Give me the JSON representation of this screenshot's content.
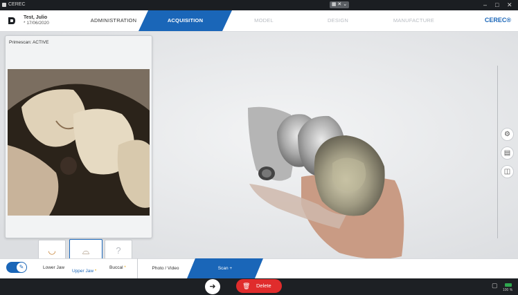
{
  "window": {
    "title": "CEREC"
  },
  "header": {
    "patient_name": "Test, Julio",
    "patient_dob": "* 17/06/2020",
    "steps": [
      "ADMINISTRATION",
      "ACQUISITION",
      "MODEL",
      "DESIGN",
      "MANUFACTURE"
    ],
    "brand": "CEREC®"
  },
  "live_panel": {
    "label": "Primescan: ACTIVE"
  },
  "scan_catalog": {
    "items": [
      {
        "label": "Lower Jaw"
      },
      {
        "label": "Upper Jaw",
        "marker": "*"
      },
      {
        "label": "Buccal",
        "marker": "*"
      }
    ],
    "placeholder_glyph": "?"
  },
  "phases": {
    "photo": "Photo / Video",
    "scan": "Scan +"
  },
  "footer": {
    "delete_label": "Delete",
    "status_percent": "100 %"
  },
  "icons": {
    "back": "arrow-left-icon",
    "delete": "trash-icon",
    "tools": [
      "settings-icon",
      "analysis-icon",
      "notes-icon"
    ]
  },
  "colors": {
    "accent": "#1a66b8",
    "danger": "#e02c2c"
  }
}
